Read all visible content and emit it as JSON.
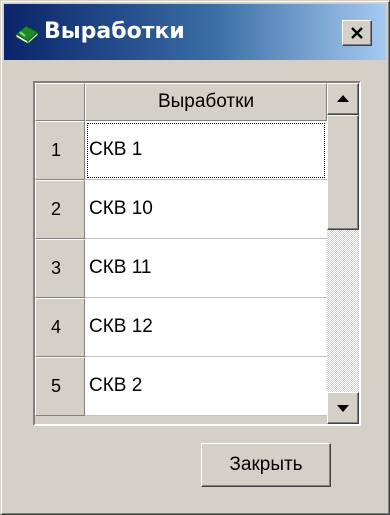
{
  "window": {
    "title": "Выработки",
    "icon": "green-book-icon",
    "close_icon": "close-icon",
    "colors": {
      "title_start": "#0a246a",
      "title_end": "#a6caf0",
      "face": "#d4d0c8"
    }
  },
  "grid": {
    "column_header": "Выработки",
    "rows": [
      {
        "num": "1",
        "value": "СКВ 1"
      },
      {
        "num": "2",
        "value": "СКВ 10"
      },
      {
        "num": "3",
        "value": "СКВ 11"
      },
      {
        "num": "4",
        "value": "СКВ 12"
      },
      {
        "num": "5",
        "value": "СКВ 2"
      }
    ],
    "selected_row": 1
  },
  "footer": {
    "close_label": "Закрыть"
  }
}
